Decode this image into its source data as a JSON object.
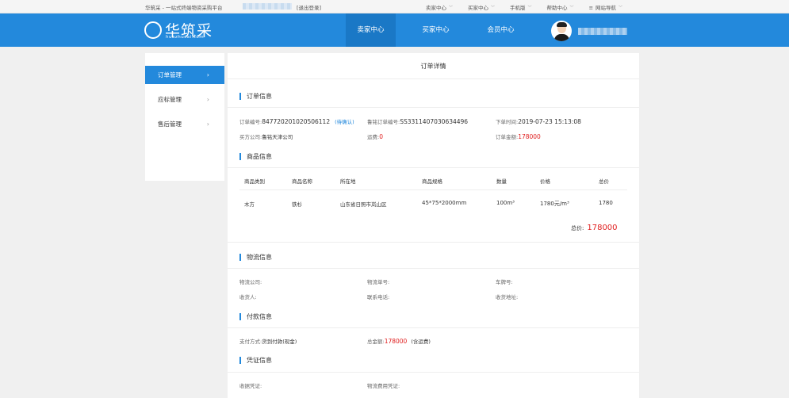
{
  "topbar": {
    "tagline": "华筑采 - 一站式终端物资采购平台",
    "logout": "[退出登录]",
    "links": [
      {
        "label": "卖家中心"
      },
      {
        "label": "买家中心"
      },
      {
        "label": "手机版"
      },
      {
        "label": "帮助中心"
      },
      {
        "label": "网站导航"
      }
    ]
  },
  "header": {
    "logo_text": "华筑采",
    "logo_sub": "huazhucai.com",
    "nav": [
      {
        "label": "卖家中心",
        "active": true
      },
      {
        "label": "买家中心",
        "active": false
      },
      {
        "label": "会员中心",
        "active": false
      }
    ],
    "colors": {
      "brand": "#2389dc",
      "active_tab": "#1a78c6"
    }
  },
  "sidebar": {
    "items": [
      {
        "label": "订单管理",
        "active": true
      },
      {
        "label": "应标管理",
        "active": false
      },
      {
        "label": "售后管理",
        "active": false
      }
    ]
  },
  "main": {
    "page_title": "订单详情",
    "order_info": {
      "title": "订单信息",
      "order_no_label": "订单编号:",
      "order_no": "847720201020506112",
      "status": "(待确认)",
      "lubao_no_label": "鲁铭订单编号:",
      "lubao_no": "SS3311407030634496",
      "order_time_label": "下单时间:",
      "order_time": "2019-07-23 15:13:08",
      "buyer_label": "买方公司:",
      "buyer": "鲁铭天津公司",
      "freight_label": "运费:",
      "freight": "0",
      "amount_label": "订单金额:",
      "amount": "178000"
    },
    "goods_info": {
      "title": "商品信息",
      "headers": [
        "商品类别",
        "商品名称",
        "所在地",
        "商品规格",
        "数量",
        "价格",
        "总价"
      ],
      "rows": [
        [
          "木方",
          "铁杉",
          "山东省日照市岚山区",
          "45*75*2000mm",
          "100m³",
          "1780元/m³",
          "1780"
        ]
      ],
      "total_label": "总价:",
      "total": "178000"
    },
    "logistics": {
      "title": "物流信息",
      "company_label": "物流公司:",
      "tracking_label": "物流单号:",
      "plate_label": "车牌号:",
      "receiver_label": "收货人:",
      "phone_label": "联系电话:",
      "address_label": "收货地址:"
    },
    "payment": {
      "title": "付款信息",
      "method_label": "支付方式:",
      "method": "货到付款(现金)",
      "total_label": "总金额:",
      "total": "178000",
      "note": "(含运费)"
    },
    "voucher": {
      "title": "凭证信息",
      "receipt_label": "收据凭证:",
      "freight_label": "物流费用凭证:"
    }
  }
}
